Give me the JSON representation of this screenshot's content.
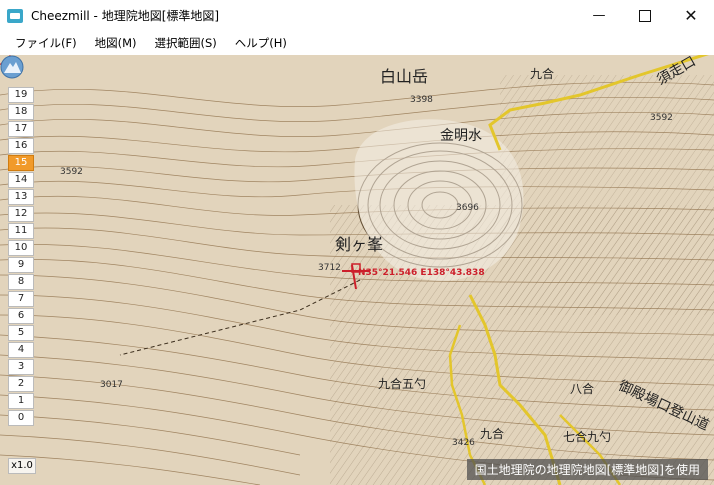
{
  "window": {
    "title": "Cheezmill - 地理院地図[標準地図]",
    "icons": {
      "minimize": "minimize-icon",
      "maximize": "maximize-icon",
      "close": "close-icon"
    }
  },
  "menu": {
    "items": [
      {
        "label": "ファイル(F)"
      },
      {
        "label": "地図(M)"
      },
      {
        "label": "選択範囲(S)"
      },
      {
        "label": "ヘルプ(H)"
      }
    ]
  },
  "map": {
    "labels": {
      "peak_name": "白山岳",
      "spring_name": "金明水",
      "cliff_name": "剣ヶ峯",
      "ninth_station": "九合五勺",
      "eighth_station": "八合",
      "trail_name": "御殿場口登山道",
      "seventh_station": "七合九勺",
      "bottom_label": "九合",
      "right_label": "須走口",
      "top_right_station": "九合"
    },
    "elevations": {
      "e1": "3592",
      "e2": "3592",
      "e3": "3696",
      "e4": "3712",
      "e5": "3398",
      "e6": "3017",
      "e7": "3426"
    },
    "coordinate_readout": "N35°21.546 E138°43.838",
    "attribution": "国土地理院の地理院地図[標準地図]を使用",
    "scale_label": "x1.0",
    "zoom": {
      "levels": [
        "19",
        "18",
        "17",
        "16",
        "15",
        "14",
        "13",
        "12",
        "11",
        "10",
        "9",
        "8",
        "7",
        "6",
        "5",
        "4",
        "3",
        "2",
        "1",
        "0"
      ],
      "active": "15"
    }
  },
  "colors": {
    "map_bg": "#e2d4bc",
    "contour": "#8a6a43",
    "trail": "#e3c62c",
    "accent": "#f19a2a",
    "marker": "#cc1f2a"
  }
}
